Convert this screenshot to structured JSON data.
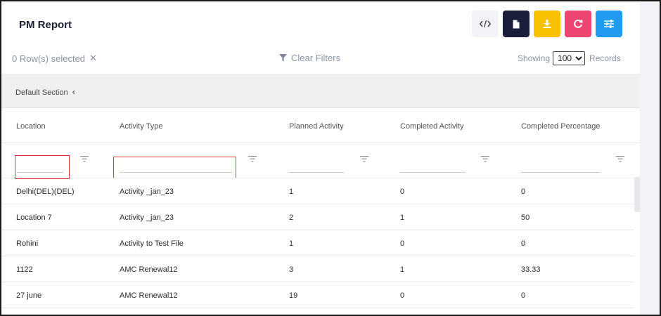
{
  "page": {
    "title": "PM Report"
  },
  "toolbar": {
    "buttons": [
      {
        "name": "code-view-button",
        "icon": "code-icon",
        "bg": "#f1f3f6",
        "fg": "#333333"
      },
      {
        "name": "document-button",
        "icon": "document-icon",
        "bg": "#1b1e3a",
        "fg": "#ffffff"
      },
      {
        "name": "download-button",
        "icon": "download-icon",
        "bg": "#f8c100",
        "fg": "#ffffff"
      },
      {
        "name": "refresh-button",
        "icon": "refresh-icon",
        "bg": "#ee4672",
        "fg": "#ffffff"
      },
      {
        "name": "settings-button",
        "icon": "sliders-icon",
        "bg": "#1f9cf0",
        "fg": "#ffffff"
      }
    ]
  },
  "selection": {
    "text": "0 Row(s) selected",
    "clear_glyph": "✕"
  },
  "filters": {
    "clear_label": "Clear Filters"
  },
  "records": {
    "showing_label": "Showing",
    "value": "100",
    "options": [
      "100"
    ],
    "records_label": "Records"
  },
  "section": {
    "label": "Default Section",
    "chevron": "‹"
  },
  "table": {
    "columns": [
      "Location",
      "Activity Type",
      "Planned Activity",
      "Completed Activity",
      "Completed Percentage"
    ],
    "rows": [
      [
        "Delhi(DEL)(DEL)",
        "Activity _jan_23",
        "1",
        "0",
        "0"
      ],
      [
        "Location 7",
        "Activity _jan_23",
        "2",
        "1",
        "50"
      ],
      [
        "Rohini",
        "Activity to Test File",
        "1",
        "0",
        "0"
      ],
      [
        "1122",
        "AMC Renewal12",
        "3",
        "1",
        "33.33"
      ],
      [
        "27 june",
        "AMC Renewal12",
        "19",
        "0",
        "0"
      ]
    ]
  },
  "colors": {
    "highlight_box": "#e0333a",
    "muted_text": "#8a93a6",
    "section_bg": "#f0f0f0"
  }
}
